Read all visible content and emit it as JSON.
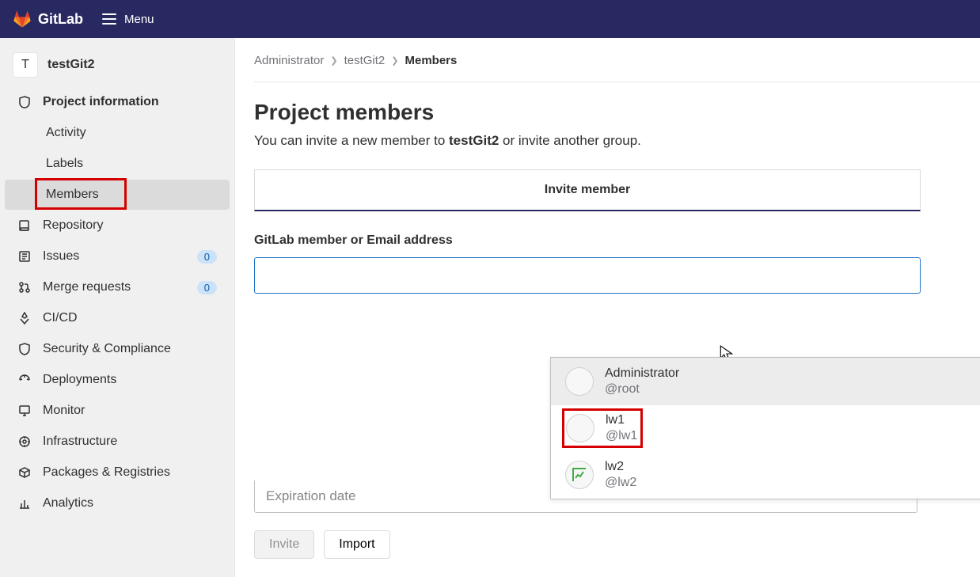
{
  "navbar": {
    "brand": "GitLab",
    "menu_label": "Menu"
  },
  "project": {
    "avatar_letter": "T",
    "name": "testGit2"
  },
  "sidebar": {
    "project_info": "Project information",
    "activity": "Activity",
    "labels": "Labels",
    "members": "Members",
    "repository": "Repository",
    "issues": "Issues",
    "issues_count": "0",
    "merge_requests": "Merge requests",
    "mr_count": "0",
    "cicd": "CI/CD",
    "security": "Security & Compliance",
    "deployments": "Deployments",
    "monitor": "Monitor",
    "infrastructure": "Infrastructure",
    "packages": "Packages & Registries",
    "analytics": "Analytics"
  },
  "breadcrumbs": {
    "root": "Administrator",
    "proj": "testGit2",
    "current": "Members"
  },
  "page": {
    "title": "Project members",
    "subtitle_pre": "You can invite a new member to ",
    "subtitle_bold": "testGit2",
    "subtitle_post": " or invite another group."
  },
  "tab": {
    "invite_member": "Invite member"
  },
  "field": {
    "member_label": "GitLab member or Email address"
  },
  "dropdown": [
    {
      "name": "Administrator",
      "user": "@root"
    },
    {
      "name": "lw1",
      "user": "@lw1"
    },
    {
      "name": "lw2",
      "user": "@lw2"
    }
  ],
  "expiration": {
    "placeholder": "Expiration date"
  },
  "buttons": {
    "invite": "Invite",
    "import": "Import"
  }
}
